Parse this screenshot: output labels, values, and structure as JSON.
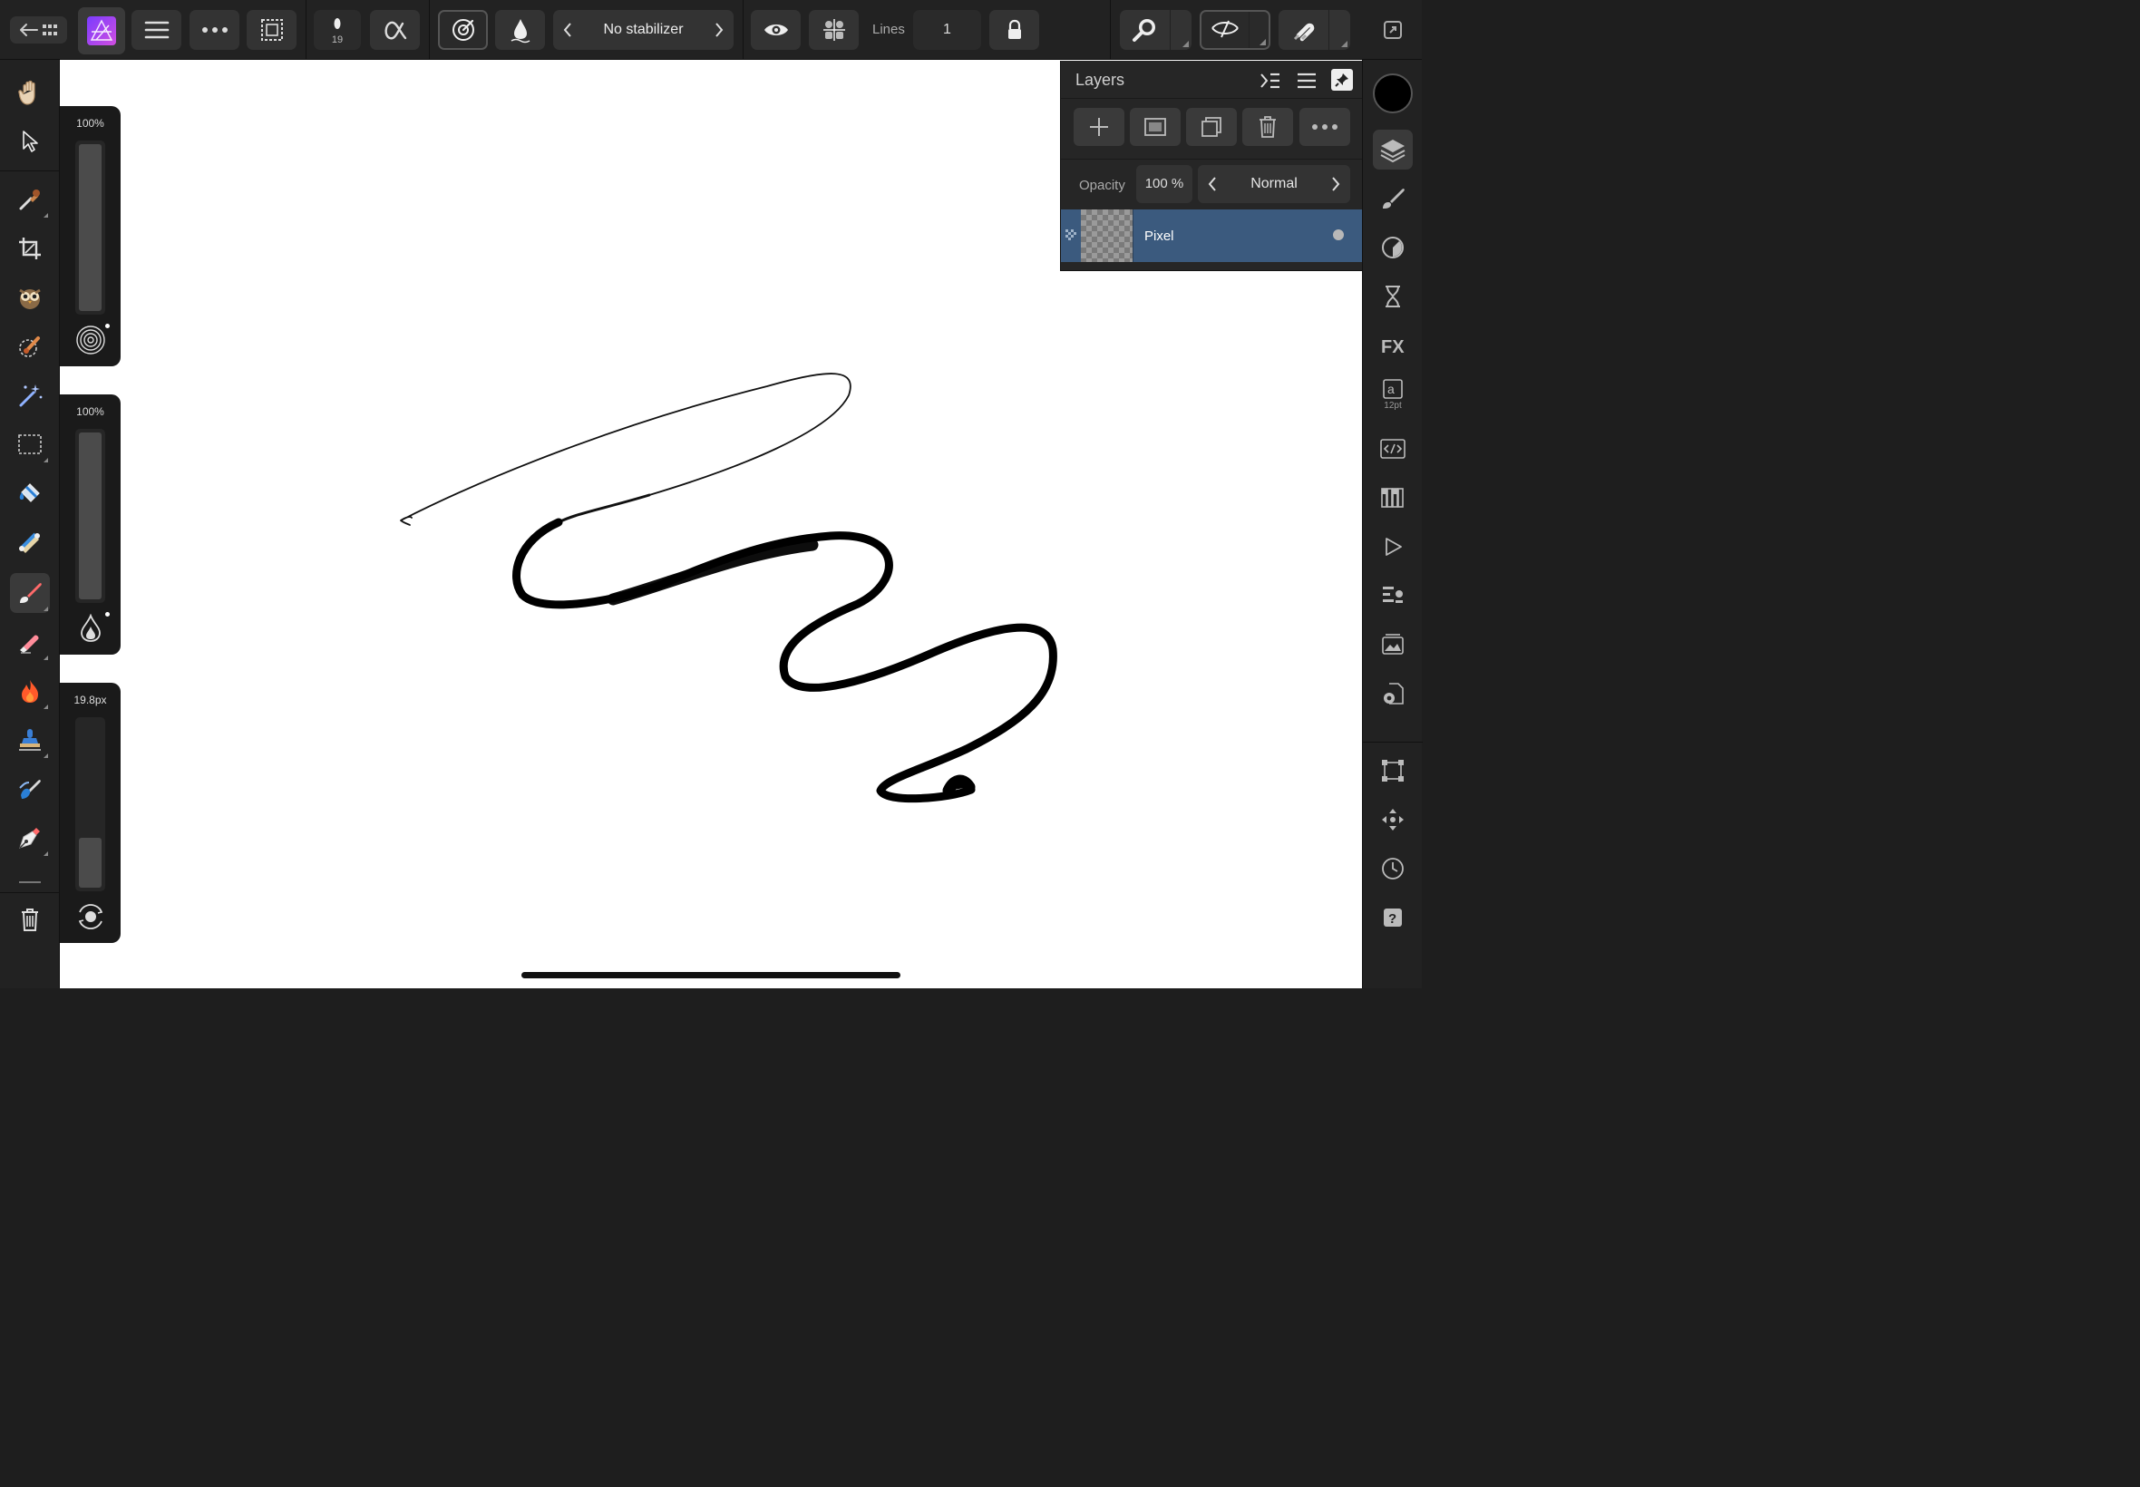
{
  "toolbar": {
    "brush_size_value": "19",
    "stabilizer_label": "No stabilizer",
    "lines_label": "Lines",
    "lines_value": "1"
  },
  "sliders": {
    "opacity_value": "100%",
    "opacity_level": 1.0,
    "flow_value": "100%",
    "flow_level": 1.0,
    "width_value": "19.8px",
    "width_level": 0.3
  },
  "layers_panel": {
    "title": "Layers",
    "opacity_label": "Opacity",
    "opacity_value": "100 %",
    "blend_mode": "Normal",
    "layers": [
      {
        "name": "Pixel",
        "selected": true
      }
    ]
  },
  "studio": {
    "text_size_label": "12pt",
    "primary_color": "#000000"
  },
  "colors": {
    "accent": "#3b5a7e",
    "app_icon_gradient_start": "#7a3cff",
    "app_icon_gradient_end": "#d14ee0"
  }
}
